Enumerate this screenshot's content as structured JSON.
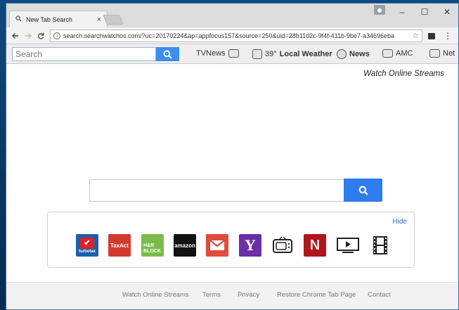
{
  "tab": {
    "title": "New Tab Search",
    "close": "×"
  },
  "window": {
    "minimize": "–",
    "maximize": "☐",
    "close": "✕"
  },
  "address": {
    "url": "search.searchwatchos.com/?uc=20170224&ap=appfocus157&source=250&uid=28b11d2c-9f4f-411b-9be7-a34696eba"
  },
  "toolbar": {
    "search_placeholder": "Search",
    "tvnews": "TVNews",
    "temperature": "39°",
    "weather": "Local Weather",
    "news": "News",
    "amc": "AMC",
    "net": "Net"
  },
  "content": {
    "watch_link": "Watch Online Streams",
    "hide_label": "Hide",
    "tiles": {
      "turbotax": "turbotax",
      "taxact": "TaxAct",
      "hrblock": "H&R BLOCK",
      "amazon": "amazon",
      "yahoo": "Y",
      "netflix": "N"
    }
  },
  "footer": {
    "links": [
      "Watch Online Streams",
      "Terms",
      "Privacy",
      "Restore Chrome Tab Page",
      "Contact"
    ]
  },
  "colors": {
    "accent": "#2d7cf0",
    "link": "#2d6fcf"
  }
}
